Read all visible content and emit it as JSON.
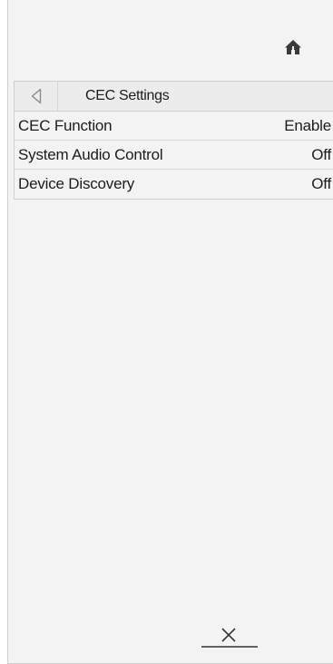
{
  "header": {
    "home_icon": "home-icon"
  },
  "menu": {
    "title": "CEC Settings",
    "back_icon": "back-triangle-icon",
    "items": [
      {
        "label": "CEC Function",
        "value": "Enable"
      },
      {
        "label": "System Audio Control",
        "value": "Off"
      },
      {
        "label": "Device Discovery",
        "value": "Off"
      }
    ]
  },
  "footer": {
    "close_icon": "close-icon"
  }
}
